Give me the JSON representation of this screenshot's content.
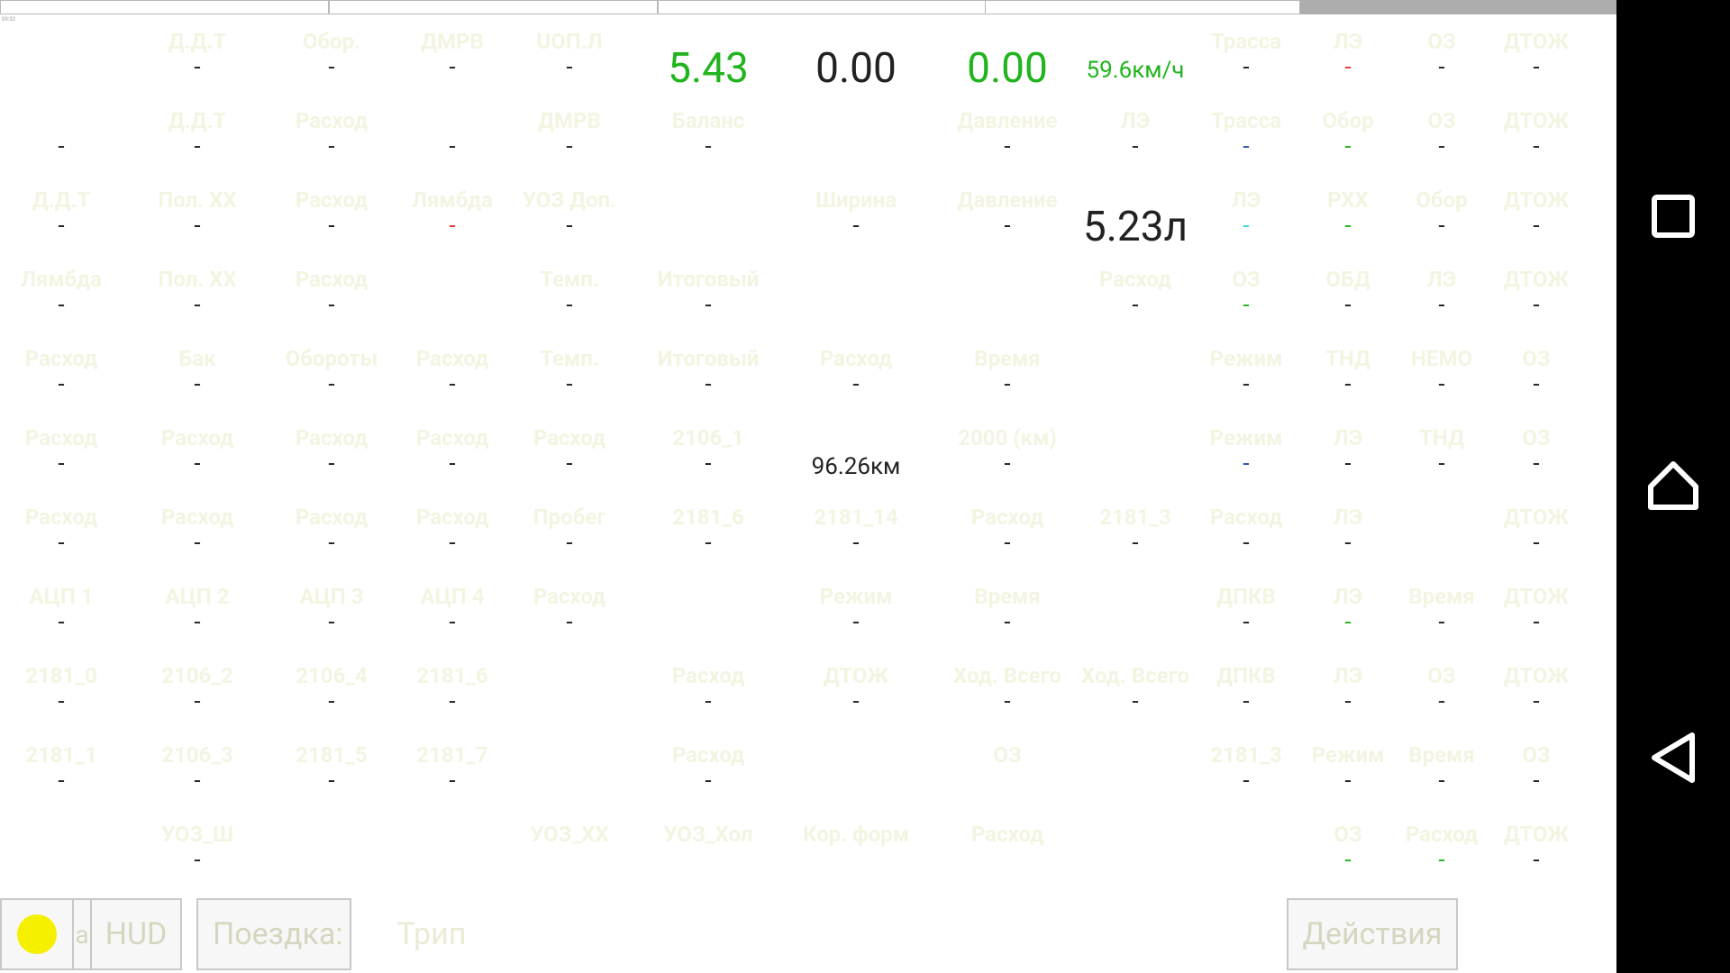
{
  "colors": {
    "green": "#22b41e",
    "dark": "#222222",
    "red": "#e53935",
    "blue": "#2f4db0",
    "cyan": "#3cd6e0",
    "navbar": "#000000"
  },
  "tiny_label": "09:32",
  "rows": [
    {
      "cells": [
        {
          "label": "Д.Д.Т",
          "value": "-"
        },
        {
          "label": "Обор.",
          "value": "-"
        },
        {
          "label": "ДМРВ",
          "value": "-"
        },
        {
          "label": "UОП.Л",
          "value": "-"
        },
        {
          "label": "",
          "value": "5.43",
          "style": "big",
          "color": "green"
        },
        {
          "label": "",
          "value": "0.00",
          "style": "big",
          "color": "dark"
        },
        {
          "label": "",
          "value": "0.00",
          "style": "big",
          "color": "green"
        },
        {
          "label": "",
          "value": "59.6км/ч",
          "style": "mid",
          "color": "green"
        },
        {
          "label": "Трасса",
          "value": "-"
        },
        {
          "label": "ЛЭ",
          "value": "-",
          "color": "red"
        },
        {
          "label": "ОЗ",
          "value": "-"
        },
        {
          "label": "ДТОЖ",
          "value": "-"
        }
      ]
    },
    {
      "cells": [
        {
          "label": "",
          "value": "-"
        },
        {
          "label": "Д.Д.Т",
          "value": "-"
        },
        {
          "label": "Расход",
          "value": "-"
        },
        {
          "label": "",
          "value": "-"
        },
        {
          "label": "ДМРВ",
          "value": "-"
        },
        {
          "label": "Баланс",
          "value": "-"
        },
        {
          "label": "",
          "value": ""
        },
        {
          "label": "Давление",
          "value": "-"
        },
        {
          "label": "ЛЭ",
          "value": "-"
        },
        {
          "label": "Трасса",
          "value": "-",
          "color": "blue"
        },
        {
          "label": "Обор",
          "value": "-",
          "color": "green"
        },
        {
          "label": "ОЗ",
          "value": "-"
        },
        {
          "label": "ДТОЖ",
          "value": "-"
        }
      ]
    },
    {
      "cells": [
        {
          "label": "Д.Д.Т",
          "value": "-"
        },
        {
          "label": "Пол. ХХ",
          "value": "-"
        },
        {
          "label": "Расход",
          "value": "-"
        },
        {
          "label": "Лямбда",
          "value": "-",
          "color": "red"
        },
        {
          "label": "УОЗ Доп.",
          "value": "-"
        },
        {
          "label": "",
          "value": ""
        },
        {
          "label": "Ширина",
          "value": "-"
        },
        {
          "label": "Давление",
          "value": "-"
        },
        {
          "label": "",
          "value": "5.23л",
          "style": "big",
          "color": "dark"
        },
        {
          "label": "ЛЭ",
          "value": "-",
          "color": "cyan"
        },
        {
          "label": "РХХ",
          "value": "-",
          "color": "green"
        },
        {
          "label": "Обор",
          "value": "-"
        },
        {
          "label": "ДТОЖ",
          "value": "-"
        }
      ]
    },
    {
      "cells": [
        {
          "label": "Лямбда",
          "value": "-"
        },
        {
          "label": "Пол. ХХ",
          "value": "-"
        },
        {
          "label": "Расход",
          "value": "-"
        },
        {
          "label": "",
          "value": ""
        },
        {
          "label": "Темп.",
          "value": "-"
        },
        {
          "label": "Итоговый",
          "value": "-"
        },
        {
          "label": "",
          "value": ""
        },
        {
          "label": "",
          "value": ""
        },
        {
          "label": "Расход",
          "value": "-"
        },
        {
          "label": "ОЗ",
          "value": "-",
          "color": "green"
        },
        {
          "label": "ОБД",
          "value": "-"
        },
        {
          "label": "ЛЭ",
          "value": "-"
        },
        {
          "label": "ДТОЖ",
          "value": "-"
        }
      ]
    },
    {
      "cells": [
        {
          "label": "Расход",
          "value": "-"
        },
        {
          "label": "Бак",
          "value": "-"
        },
        {
          "label": "Обороты",
          "value": "-"
        },
        {
          "label": "Расход",
          "value": "-"
        },
        {
          "label": "Темп.",
          "value": "-"
        },
        {
          "label": "Итоговый",
          "value": "-"
        },
        {
          "label": "Расход",
          "value": "-"
        },
        {
          "label": "Время",
          "value": "-"
        },
        {
          "label": "",
          "value": ""
        },
        {
          "label": "Режим",
          "value": "-"
        },
        {
          "label": "ТНД",
          "value": "-"
        },
        {
          "label": "НЕМО",
          "value": "-"
        },
        {
          "label": "ОЗ",
          "value": "-"
        }
      ]
    },
    {
      "cells": [
        {
          "label": "Расход",
          "value": "-"
        },
        {
          "label": "Расход",
          "value": "-"
        },
        {
          "label": "Расход",
          "value": "-"
        },
        {
          "label": "Расход",
          "value": "-"
        },
        {
          "label": "Расход",
          "value": "-"
        },
        {
          "label": "2106_1",
          "value": "-"
        },
        {
          "label": "",
          "value": "96.26км",
          "style": "mid",
          "color": "dark"
        },
        {
          "label": "2000 (км)",
          "value": "-"
        },
        {
          "label": "",
          "value": ""
        },
        {
          "label": "Режим",
          "value": "-",
          "color": "blue"
        },
        {
          "label": "ЛЭ",
          "value": "-"
        },
        {
          "label": "ТНД",
          "value": "-"
        },
        {
          "label": "ОЗ",
          "value": "-"
        }
      ]
    },
    {
      "cells": [
        {
          "label": "Расход",
          "value": "-"
        },
        {
          "label": "Расход",
          "value": "-"
        },
        {
          "label": "Расход",
          "value": "-"
        },
        {
          "label": "Расход",
          "value": "-"
        },
        {
          "label": "Пробег",
          "value": "-"
        },
        {
          "label": "2181_6",
          "value": "-"
        },
        {
          "label": "2181_14",
          "value": "-"
        },
        {
          "label": "Расход",
          "value": "-"
        },
        {
          "label": "2181_3",
          "value": "-"
        },
        {
          "label": "Расход",
          "value": "-"
        },
        {
          "label": "ЛЭ",
          "value": "-"
        },
        {
          "label": "",
          "value": ""
        },
        {
          "label": "ДТОЖ",
          "value": "-"
        }
      ]
    },
    {
      "cells": [
        {
          "label": "АЦП 1",
          "value": "-"
        },
        {
          "label": "АЦП 2",
          "value": "-"
        },
        {
          "label": "АЦП 3",
          "value": "-"
        },
        {
          "label": "АЦП 4",
          "value": "-"
        },
        {
          "label": "Расход",
          "value": "-"
        },
        {
          "label": "",
          "value": ""
        },
        {
          "label": "Режим",
          "value": "-"
        },
        {
          "label": "Время",
          "value": "-"
        },
        {
          "label": "",
          "value": ""
        },
        {
          "label": "ДПКВ",
          "value": "-"
        },
        {
          "label": "ЛЭ",
          "value": "-",
          "color": "green"
        },
        {
          "label": "Время",
          "value": "-"
        },
        {
          "label": "ДТОЖ",
          "value": "-"
        }
      ]
    },
    {
      "cells": [
        {
          "label": "2181_0",
          "value": "-"
        },
        {
          "label": "2106_2",
          "value": "-"
        },
        {
          "label": "2106_4",
          "value": "-"
        },
        {
          "label": "2181_6",
          "value": "-"
        },
        {
          "label": "",
          "value": ""
        },
        {
          "label": "Расход",
          "value": "-"
        },
        {
          "label": "ДТОЖ",
          "value": "-"
        },
        {
          "label": "Ход. Всего",
          "value": "-"
        },
        {
          "label": "Ход. Всего",
          "value": "-"
        },
        {
          "label": "ДПКВ",
          "value": "-"
        },
        {
          "label": "ЛЭ",
          "value": "-"
        },
        {
          "label": "ОЗ",
          "value": "-"
        },
        {
          "label": "ДТОЖ",
          "value": "-"
        }
      ]
    },
    {
      "cells": [
        {
          "label": "2181_1",
          "value": "-"
        },
        {
          "label": "2106_3",
          "value": "-"
        },
        {
          "label": "2181_5",
          "value": "-"
        },
        {
          "label": "2181_7",
          "value": "-"
        },
        {
          "label": "",
          "value": ""
        },
        {
          "label": "Расход",
          "value": "-"
        },
        {
          "label": "",
          "value": ""
        },
        {
          "label": "ОЗ",
          "value": ""
        },
        {
          "label": "",
          "value": ""
        },
        {
          "label": "2181_3",
          "value": "-"
        },
        {
          "label": "Режим",
          "value": "-"
        },
        {
          "label": "Время",
          "value": "-"
        },
        {
          "label": "ОЗ",
          "value": "-"
        }
      ]
    },
    {
      "cells": [
        {
          "label": "",
          "value": ""
        },
        {
          "label": "УОЗ_Ш",
          "value": "-"
        },
        {
          "label": "",
          "value": ""
        },
        {
          "label": "",
          "value": ""
        },
        {
          "label": "УОЗ_ХХ",
          "value": ""
        },
        {
          "label": "УОЗ_Хол",
          "value": ""
        },
        {
          "label": "Кор. форм",
          "value": ""
        },
        {
          "label": "Расход",
          "value": ""
        },
        {
          "label": "",
          "value": ""
        },
        {
          "label": "",
          "value": ""
        },
        {
          "label": "ОЗ",
          "value": "-",
          "color": "green"
        },
        {
          "label": "Расход",
          "value": "-",
          "color": "green"
        },
        {
          "label": "ДТОЖ",
          "value": "-"
        }
      ]
    }
  ],
  "bottom_bar": {
    "lamp_color": "#f4f000",
    "hud_prefix": "a",
    "hud_label": "HUD",
    "trip_label": "Поездка:",
    "trip_suffix": "Трип",
    "actions_label": "Действия"
  },
  "navbar": {
    "icons": [
      "square-recents-icon",
      "home-icon",
      "back-triangle-icon"
    ]
  }
}
